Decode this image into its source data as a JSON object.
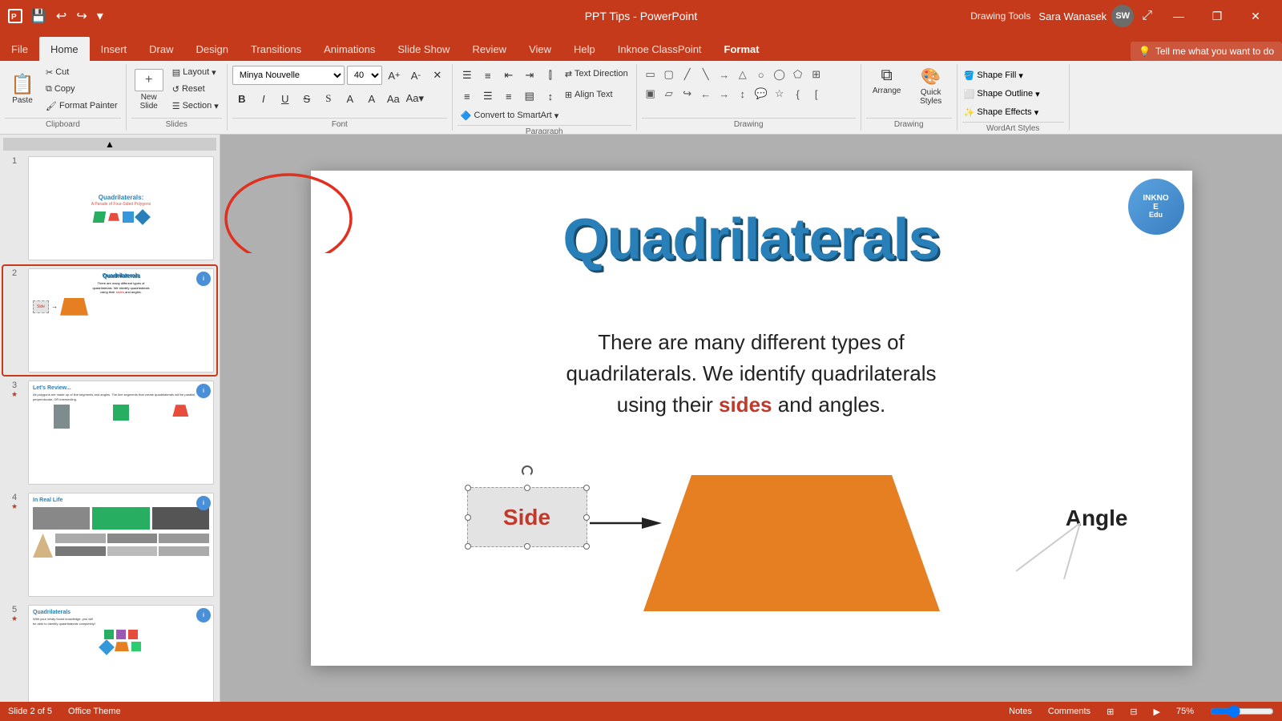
{
  "titlebar": {
    "title": "PPT Tips - PowerPoint",
    "drawing_tools": "Drawing Tools",
    "user_name": "Sara Wanasek",
    "user_initials": "SW",
    "save_icon": "💾",
    "undo_icon": "↩",
    "redo_icon": "↪",
    "window_minimize": "—",
    "window_restore": "❐",
    "window_close": "✕"
  },
  "ribbon_tabs": {
    "tabs": [
      {
        "id": "file",
        "label": "File"
      },
      {
        "id": "home",
        "label": "Home",
        "active": true
      },
      {
        "id": "insert",
        "label": "Insert"
      },
      {
        "id": "draw",
        "label": "Draw"
      },
      {
        "id": "design",
        "label": "Design"
      },
      {
        "id": "transitions",
        "label": "Transitions"
      },
      {
        "id": "animations",
        "label": "Animations"
      },
      {
        "id": "slideshow",
        "label": "Slide Show"
      },
      {
        "id": "review",
        "label": "Review"
      },
      {
        "id": "view",
        "label": "View"
      },
      {
        "id": "help",
        "label": "Help"
      },
      {
        "id": "inknoe",
        "label": "Inknoe ClassPoint"
      },
      {
        "id": "format",
        "label": "Format"
      }
    ],
    "tell_me": "Tell me what you want to do",
    "tell_me_icon": "💡"
  },
  "ribbon": {
    "clipboard": {
      "label": "Clipboard",
      "paste_label": "Paste",
      "format_painter_label": "Format\nPainter"
    },
    "slides": {
      "label": "Slides",
      "new_slide_label": "New\nSlide",
      "layout_label": "Layout",
      "reset_label": "Reset",
      "section_label": "Section"
    },
    "font": {
      "label": "Font",
      "font_name": "Minya Nouvelle",
      "font_size": "40",
      "bold": "B",
      "italic": "I",
      "underline": "U",
      "strikethrough": "S",
      "increase_size": "A↑",
      "decrease_size": "A↓",
      "clear_format": "✕"
    },
    "paragraph": {
      "label": "Paragraph",
      "text_direction_label": "Text Direction",
      "align_text_label": "Align Text",
      "convert_smartart_label": "Convert to SmartArt"
    },
    "drawing": {
      "label": "Drawing",
      "arrange_label": "Arrange",
      "quick_styles_label": "Quick\nStyles"
    },
    "shape_format": {
      "shape_fill_label": "Shape Fill",
      "shape_outline_label": "Shape Outline",
      "shape_effects_label": "Shape Effects"
    }
  },
  "slides": [
    {
      "num": "1",
      "has_badge": false,
      "title": "Quadrilaterals:",
      "subtitle": "A Parade of Four-Sided Polygons"
    },
    {
      "num": "2",
      "has_badge": true,
      "active": true
    },
    {
      "num": "3",
      "has_badge": true,
      "label": "Let's Review..."
    },
    {
      "num": "4",
      "has_badge": true,
      "label": "In Real Life"
    },
    {
      "num": "5",
      "has_badge": true,
      "label": "Quadrilaterals"
    }
  ],
  "slide_content": {
    "title": "Quadrilaterals",
    "body_text1": "There are many different types of",
    "body_text2": "quadrilaterals. We identify quadrilaterals",
    "body_text3": "using their",
    "sides_word": "sides",
    "body_text4": "and angles.",
    "side_label": "Side",
    "angle_label": "Angle"
  },
  "statusbar": {
    "slide_count": "Slide 2 of 5",
    "theme": "Office Theme",
    "notes": "Notes",
    "comments": "Comments"
  },
  "inknoe": {
    "line1": "INKNO",
    "line2": "E",
    "line3": "Edu"
  }
}
